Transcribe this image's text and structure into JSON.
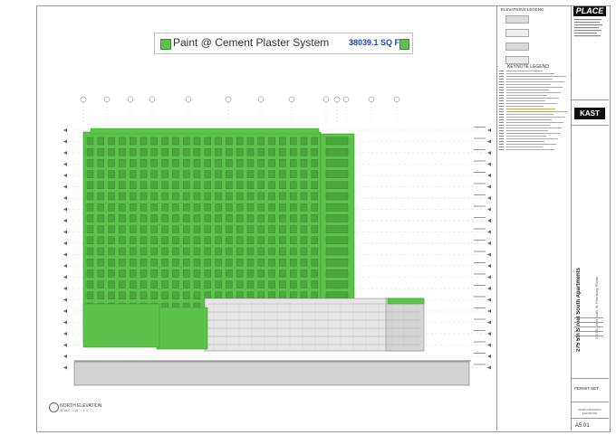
{
  "callout": {
    "label": "Paint @ Cement Plaster System",
    "area": "38039.1 SQ FT",
    "color": "#5cc24c"
  },
  "elevation": {
    "title": "NORTH ELEVATION",
    "scale": "SCALE: 1/16\" = 1'-0\""
  },
  "legend": {
    "title": "ELEVATIONS LEGEND"
  },
  "keynote": {
    "title": "KEYNOTE LEGEND"
  },
  "title_block": {
    "firm_logo": "PLACE",
    "firm_logo2": "KAST",
    "project_name": "275 5th Street South Apartments",
    "project_sub": "275 5th Street South, St. Petersburg, Florida",
    "permit": "PERMIT SET",
    "sheet_title": "NORTH BUILDING ELEVATION",
    "sheet_number": "A5.01"
  },
  "colors": {
    "paint": "#5cc24c",
    "paint_dark": "#3e9a33",
    "concrete": "#cfcfcf",
    "line": "#6f6f6f"
  }
}
